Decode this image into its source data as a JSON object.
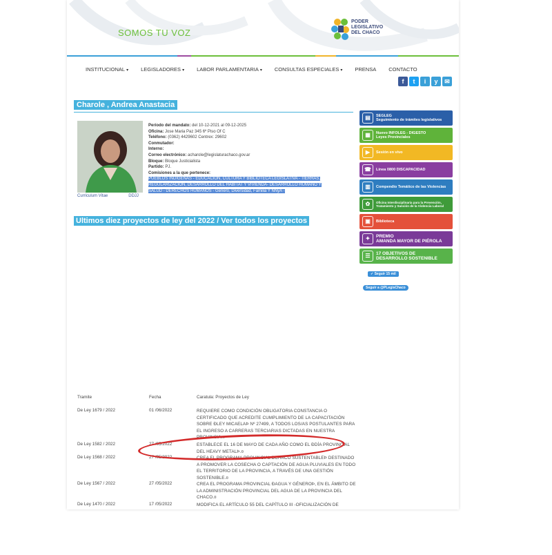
{
  "header": {
    "slogan": "SOMOS TU VOZ",
    "logo_text": "PODER LEGISLATIVO DEL CHACO",
    "bar_colors": [
      "#3aa0d8",
      "#9c4aa0",
      "#6bbf3a",
      "#f0b429",
      "#3aa0d8",
      "#6bbf3a"
    ]
  },
  "nav": {
    "items": [
      {
        "label": "INSTITUCIONAL",
        "caret": "▾"
      },
      {
        "label": "LEGISLADORES",
        "caret": "▾"
      },
      {
        "label": "LABOR PARLAMENTARIA",
        "caret": "▾"
      },
      {
        "label": "CONSULTAS ESPECIALES",
        "caret": "▾"
      },
      {
        "label": "PRENSA",
        "caret": ""
      },
      {
        "label": "CONTACTO",
        "caret": ""
      }
    ]
  },
  "social": [
    "f",
    "t",
    "i",
    "y",
    "✉"
  ],
  "legislator": {
    "name": "Charole , Andrea Anastacia",
    "curriculum": "Curriculum Vitae",
    "ddjj": "DDJJ",
    "periodo_label": "Período del mandato:",
    "periodo": "del 10-12-2021 al 09-12-2025",
    "oficina_label": "Oficina:",
    "oficina": "Jose Maria Paz 345 6º Piso Of C",
    "telefono_label": "Teléfono:",
    "telefono": "(0362) 4429602   Centrex: 29602",
    "conmutador_label": "Conmutador:",
    "interno_label": "Interno:",
    "correo_label": "Correo electrónico:",
    "correo": "acharole@legislaturachaco.gov.ar",
    "bloque_label": "Bloque:",
    "bloque": "Bloque Justicialista",
    "partido_label": "Partido:",
    "partido": "PJ.",
    "comisiones_label": "Comisiones a la que pertenece:",
    "comisiones": "PUEBLOS INDIGENAS - EDUCACIÓN, CULTURA Y BIBLIOTECA LEGISLATIVA - TIERRAS, REGULARIZACION, DESARROLLO DEL HABITAT Y VIVIENDA- DESARROLLO HUMANO Y SALUD - DERECHOS HUMANOS - Genero, Diversidad, Familia Y NNyA -"
  },
  "section_title": "Ultimos diez proyectos de ley del 2022 / Ver todos los proyectos",
  "sidebar": [
    {
      "label": "SEGLEG\nSeguimiento de trámites legislativos",
      "color": "#2b5fa8",
      "icon": "▤"
    },
    {
      "label": "Nuevo INFOLEG - DIGESTO\nLeyes Provinciales",
      "color": "#5fb33a",
      "icon": "▦"
    },
    {
      "label": "Sesión en vivo",
      "color": "#f2b824",
      "icon": "▶"
    },
    {
      "label": "Línea 0800 DISCAPACIDAD",
      "color": "#8a3ea0",
      "icon": "☎"
    },
    {
      "label": "Compendio Temático de las Violencias",
      "color": "#2e7dc0",
      "icon": "▥"
    },
    {
      "label": "Oficina Interdisciplinaria para la Prevención, Tratamiento y Sanción de la Violencia Laboral",
      "color": "#3f9b3a",
      "icon": "✿"
    },
    {
      "label": "Biblioteca",
      "color": "#e4513a",
      "icon": "▣"
    },
    {
      "label": "PREMIO\nAMANDA MAYOR DE PIÉROLA",
      "color": "#7a3a98",
      "icon": "✦"
    },
    {
      "label": "17 OBJETIVOS DE\nDESARROLLO SOSTENIBLE",
      "color": "#58b34a",
      "icon": "☰"
    }
  ],
  "follow": {
    "seguir": "✓ Seguir 15 mil",
    "twitter": "Seguir a @PLegisChaco"
  },
  "table": {
    "headers": {
      "tramite": "Tramite",
      "fecha": "Fecha",
      "caratula": "Caratula: Proyectos de Ley"
    },
    "rows": [
      {
        "tramite": "De Ley 1679 / 2022",
        "fecha": "01 /06/2022",
        "caratula": "REQUIERE COMO CONDICIÓN OBLIGATORIA CONSTANCIA O CERTIFICADO QUE ACREDITE CUMPLIMIENTO DE LA CAPACITACIÓN SOBRE ÐLEY MICAELAÞ Nº 27499, A TODOS LOS/AS POSTULANTES PARA EL INGRESO A CARRERAS TERCIARIAS DICTADAS EN NUESTRA PROVINCIA.¤"
      },
      {
        "tramite": "De Ley 1582 / 2022",
        "fecha": "27 /05/2022",
        "caratula": "ESTABLECE EL 16 DE MAYO DE CADA AÑO COMO EL ÐDÍA PROVINCIAL DEL HEAVY METALÞ.¤"
      },
      {
        "tramite": "De Ley 1568 / 2022",
        "fecha": "27 /05/2022",
        "caratula": "CREA EL PROGRAMA PROVINCIAL ÐCHACO SUSTENTABLEÞ DESTINADO A PROMOVER LA COSECHA O CAPTACIÓN DE AGUA PLUVIALES EN TODO EL TERRITORIO DE LA PROVINCIA, A TRAVÉS DE UNA GESTIÓN SOSTENIBLE.¤"
      },
      {
        "tramite": "De Ley 1567 / 2022",
        "fecha": "27 /05/2022",
        "caratula": "CREA EL PROGRAMA PROVINCIAL ÐAGUA Y GÉNEROÞ, EN EL ÁMBITO DE LA ADMINISTRACIÓN PROVINCIAL DEL AGUA DE LA PROVINCIA DEL CHACO.¤"
      },
      {
        "tramite": "De Ley 1470 / 2022",
        "fecha": "17 /05/2022",
        "caratula": "MODIFICA EL ARTÍCULO 55 DEL CAPÍTULO III -OFICIALIZACIÓN DE"
      }
    ]
  },
  "annotation_color": "#d32a2a"
}
